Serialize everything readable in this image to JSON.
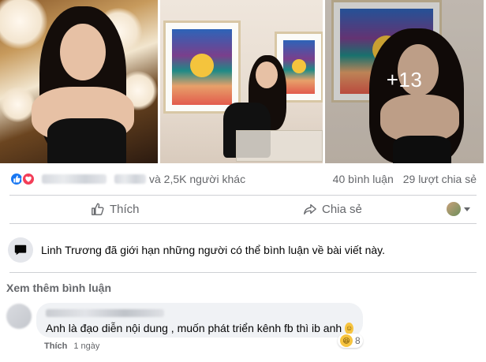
{
  "photos": {
    "more_count": "+13"
  },
  "reactions": {
    "others_text": "và 2,5K người khác",
    "comments_count": "40 bình luận",
    "shares_count": "29 lượt chia sẻ"
  },
  "actions": {
    "like_label": "Thích",
    "share_label": "Chia sẻ"
  },
  "notice": {
    "text": "Linh Trương đã giới hạn những người có thể bình luận về bài viết này."
  },
  "comments": {
    "more_label": "Xem thêm bình luận",
    "items": [
      {
        "text": "Anh là đạo diễn nội dung , muốn phát triển kênh fb thì ib anh",
        "reaction_count": "8",
        "like_label": "Thích",
        "time": "1 ngày"
      }
    ]
  },
  "colors": {
    "accent": "#1877f2",
    "love": "#f33e58",
    "secondary_text": "#65676b",
    "bubble": "#f0f2f5"
  },
  "icons": {
    "like": "thumbs-up-icon",
    "share": "share-arrow-icon",
    "comment_restricted": "speech-bubble-icon"
  }
}
